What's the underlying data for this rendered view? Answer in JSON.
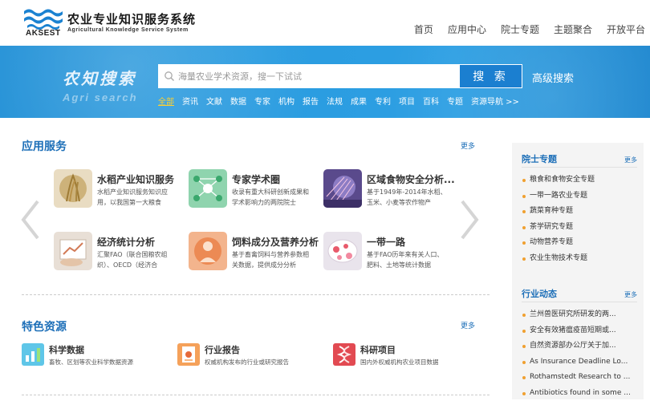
{
  "header": {
    "title": "农业专业知识服务系统",
    "subtitle": "Agricultural Knowledge Service System",
    "brand": "AKSEST",
    "nav": [
      "首页",
      "应用中心",
      "院士专题",
      "主题聚合",
      "开放平台"
    ]
  },
  "banner": {
    "title": "农知搜索",
    "subtitle": "Agri search",
    "search_placeholder": "海量农业学术资源，搜一下试试",
    "search_button": "搜 索",
    "advanced": "高级搜索",
    "categories": [
      "全部",
      "资讯",
      "文献",
      "数据",
      "专家",
      "机构",
      "报告",
      "法规",
      "成果",
      "专利",
      "项目",
      "百科",
      "专题",
      "资源导航 >>"
    ]
  },
  "services": {
    "title": "应用服务",
    "more": "更多",
    "items": [
      {
        "name": "水稻产业知识服务",
        "desc": "水稻产业知识服务知识应用，以我国第一大粮食"
      },
      {
        "name": "专家学术圈",
        "desc": "收录有重大科研创新成果和学术影响力的两院院士"
      },
      {
        "name": "区域食物安全分析...",
        "desc": "基于1949年-2014年水稻、玉米、小麦等农作物产"
      },
      {
        "name": "经济统计分析",
        "desc": "汇聚FAO（联合国粮农组织）、OECD（经济合"
      },
      {
        "name": "饲料成分及营养分析",
        "desc": "基于畜禽饲料与营养参数相关数据，提供成分分析"
      },
      {
        "name": "一带一路",
        "desc": "基于FAO历年来有关人口、肥料、土地等统计数据"
      }
    ]
  },
  "featured": {
    "title": "特色资源",
    "more": "更多",
    "items": [
      {
        "name": "科学数据",
        "desc": "畜牧、区划等农业科学数据资源"
      },
      {
        "name": "行业报告",
        "desc": "权威机构发布的行业或研究报告"
      },
      {
        "name": "科研项目",
        "desc": "国内外权威机构农业项目数据"
      }
    ]
  },
  "sidebar": {
    "topics_title": "院士专题",
    "topics_more": "更多",
    "topics": [
      "粮食和食物安全专题",
      "一带一路农业专题",
      "蔬菜育种专题",
      "茶学研究专题",
      "动物营养专题",
      "农业生物技术专题"
    ],
    "news_title": "行业动态",
    "news_more": "更多",
    "news": [
      "兰州兽医研究所研发的两...",
      "安全有效猪瘟疫苗短期或...",
      "自然资源部办公厅关于加...",
      "As Insurance Deadline Lo...",
      "Rothamstedt Research to ...",
      "Antibiotics found in some ..."
    ]
  },
  "colors": {
    "accent": "#1d6fb8",
    "banner": "#2a9ce0",
    "active_category": "#ffd02f",
    "bullet": "#f0a030"
  }
}
